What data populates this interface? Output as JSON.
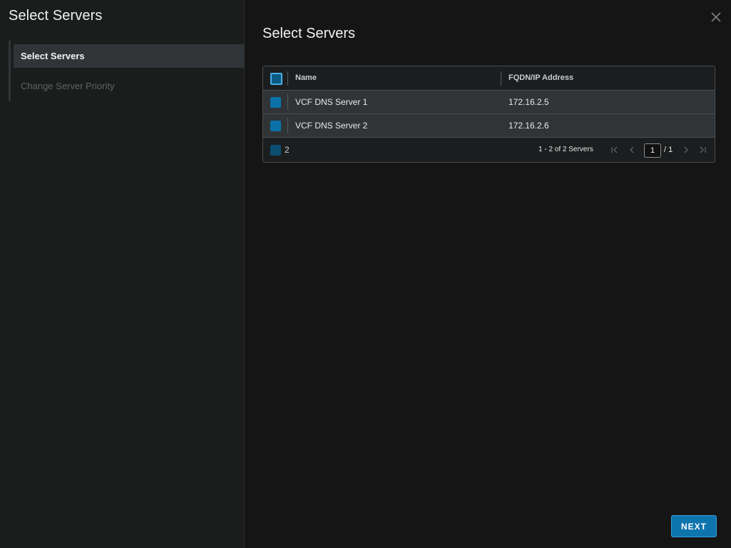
{
  "wizard": {
    "title": "Select Servers",
    "steps": [
      {
        "label": "Select Servers",
        "state": "active"
      },
      {
        "label": "Change Server Priority",
        "state": "inactive"
      }
    ]
  },
  "content": {
    "title": "Select Servers"
  },
  "grid": {
    "columns": [
      "Name",
      "FQDN/IP Address"
    ],
    "rows": [
      {
        "name": "VCF DNS Server 1",
        "ip": "172.16.2.5",
        "selected": true
      },
      {
        "name": "VCF DNS Server 2",
        "ip": "172.16.2.6",
        "selected": true
      }
    ],
    "footer": {
      "selected_count": "2",
      "summary": "1 - 2 of 2 Servers",
      "current_page": "1",
      "total_pages": "/ 1"
    }
  },
  "actions": {
    "next_label": "NEXT"
  },
  "icons": {
    "close": "close-icon",
    "first": "page-first-icon",
    "prev": "page-prev-icon",
    "next": "page-next-icon",
    "last": "page-last-icon",
    "cursor": "mouse-cursor-icon"
  },
  "colors": {
    "accent": "#0d74ae",
    "checkbox": "#0a72a8",
    "row_bg": "#303436"
  }
}
